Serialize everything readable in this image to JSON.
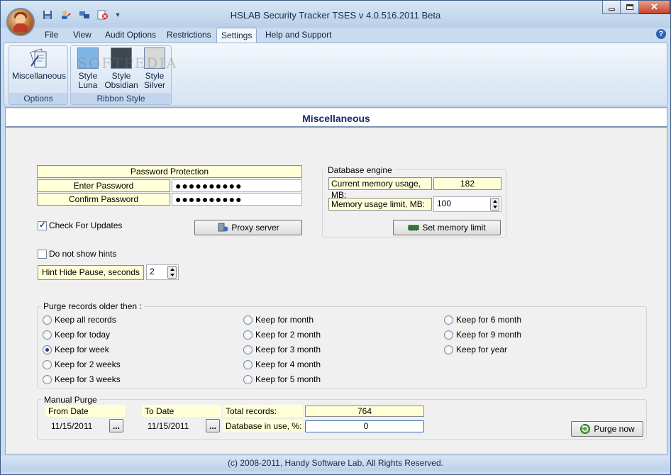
{
  "window": {
    "title": "HSLAB Security Tracker TSES v 4.0.516.2011 Beta",
    "watermark": "SOFTPEDIA"
  },
  "menu": {
    "tabs": [
      {
        "label": "File"
      },
      {
        "label": "View"
      },
      {
        "label": "Audit Options"
      },
      {
        "label": "Restrictions"
      },
      {
        "label": "Settings",
        "active": true
      },
      {
        "label": "Help and Support"
      }
    ],
    "help_icon": "?"
  },
  "ribbon": {
    "options_group": {
      "label": "Options",
      "miscellaneous": "Miscellaneous"
    },
    "style_group": {
      "label": "Ribbon Style",
      "luna": [
        "Style",
        "Luna"
      ],
      "obsidian": [
        "Style",
        "Obsidian"
      ],
      "silver": [
        "Style",
        "Silver"
      ]
    },
    "colors": {
      "luna": "#7fb6e8",
      "obsidian": "#3e4650",
      "silver": "#d8d8d8"
    }
  },
  "panel": {
    "title": "Miscellaneous",
    "password": {
      "header": "Password Protection",
      "enter_label": "Enter Password",
      "enter_value": "●●●●●●●●●●",
      "confirm_label": "Confirm Password",
      "confirm_value": "●●●●●●●●●●"
    },
    "check_updates": {
      "label": "Check For Updates",
      "checked": true
    },
    "proxy_button": "Proxy server",
    "database": {
      "title": "Database engine",
      "usage_label": "Current memory usage, MB:",
      "usage_value": "182",
      "limit_label": "Memory usage limit, MB:",
      "limit_value": "100",
      "set_button": "Set memory limit"
    },
    "hints": {
      "dont_show_label": "Do not show hints",
      "checked": false,
      "pause_label": "Hint Hide Pause, seconds",
      "pause_value": "2"
    },
    "purge": {
      "title": "Purge records older then :",
      "col1": [
        "Keep all records",
        "Keep for today",
        "Keep for week",
        "Keep for 2 weeks",
        "Keep for 3 weeks"
      ],
      "col2": [
        "Keep for month",
        "Keep for 2 month",
        "Keep for 3 month",
        "Keep for 4 month",
        "Keep for 5 month"
      ],
      "col3": [
        "Keep for 6 month",
        "Keep for 9 month",
        "Keep for year"
      ],
      "selected": "Keep for week"
    },
    "manual_purge": {
      "title": "Manual Purge",
      "from_label": "From Date",
      "from_value": "11/15/2011",
      "to_label": "To Date",
      "to_value": "11/15/2011",
      "total_label": "Total records:",
      "total_value": "764",
      "db_use_label": "Database in use, %:",
      "db_use_value": "0",
      "purge_button": "Purge now",
      "ellipsis": "..."
    }
  },
  "status": {
    "copyright": "(c) 2008-2011, Handy Software Lab, All Rights Reserved."
  }
}
